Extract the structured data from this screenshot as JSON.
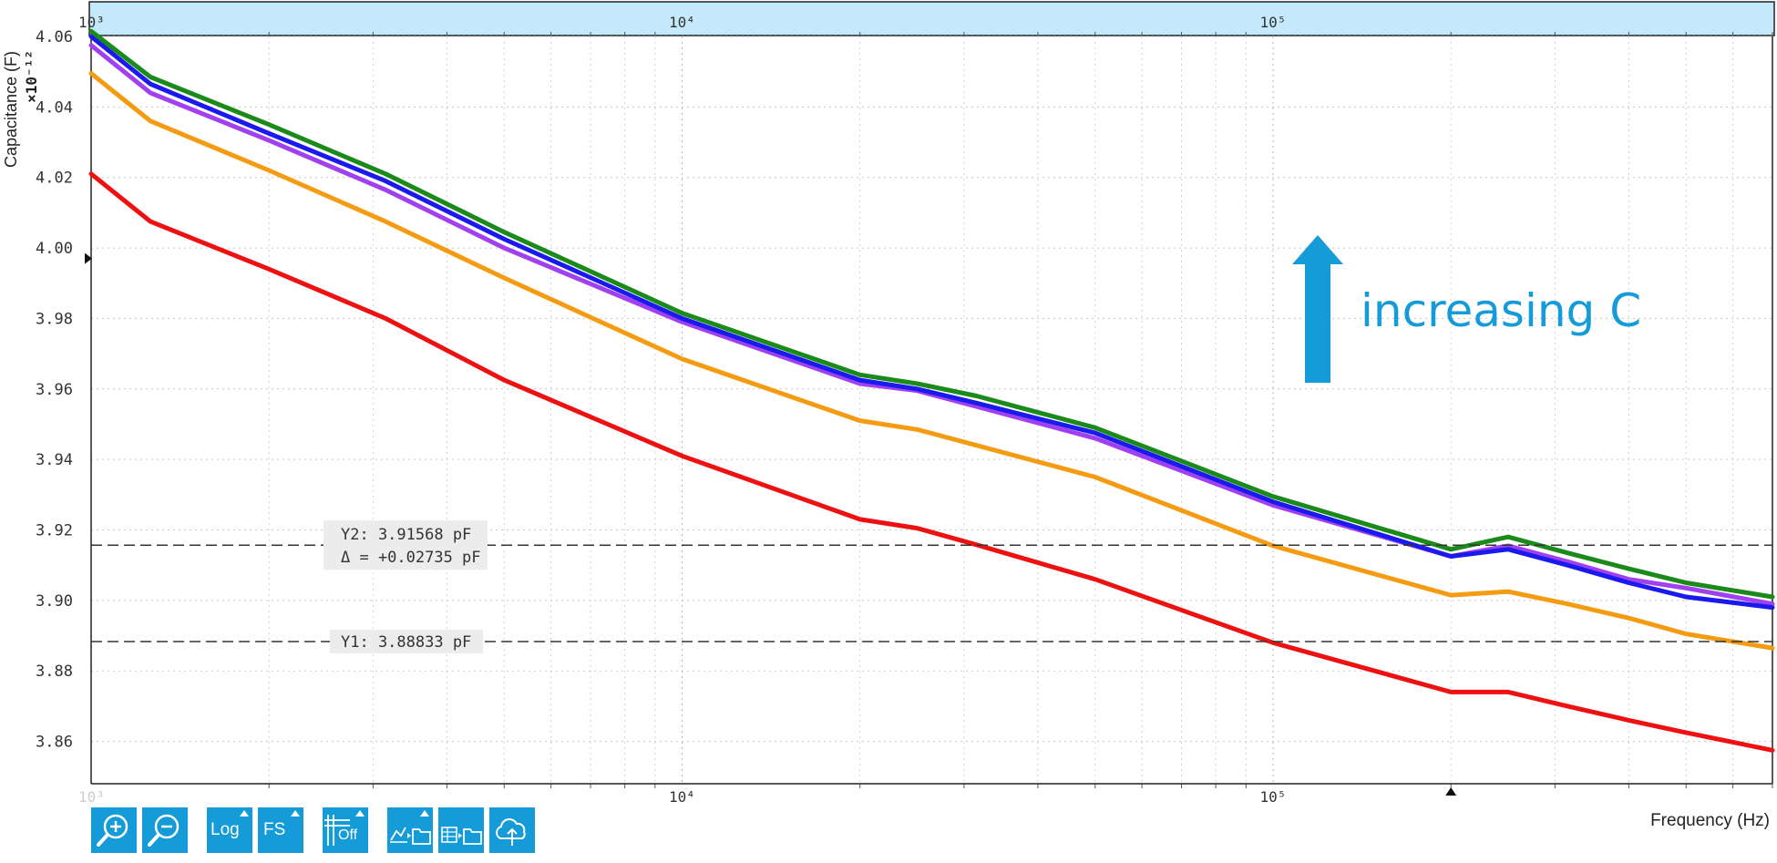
{
  "chart_data": {
    "type": "line",
    "xscale": "log",
    "x_tick_labels": [
      "10³",
      "10⁴",
      "10⁵"
    ],
    "x_tick_values": [
      1000,
      10000,
      100000
    ],
    "xlim": [
      1000,
      700000
    ],
    "ylim": [
      3.848,
      4.06
    ],
    "y_tick_labels": [
      "3.86",
      "3.88",
      "3.90",
      "3.92",
      "3.94",
      "3.96",
      "3.98",
      "4.00",
      "4.02",
      "4.04",
      "4.06"
    ],
    "y_tick_values": [
      3.86,
      3.88,
      3.9,
      3.92,
      3.94,
      3.96,
      3.98,
      4.0,
      4.02,
      4.04,
      4.06
    ],
    "y_exponent": "×10⁻¹²",
    "ylabel": "Capacitance (F)",
    "xlabel": "Frequency (Hz)",
    "grid": true,
    "x": [
      1000,
      1260,
      2000,
      3150,
      5000,
      10000,
      20000,
      25000,
      31500,
      50000,
      100000,
      200000,
      250000,
      315000,
      400000,
      500000,
      700000
    ],
    "series": [
      {
        "color": "#ee1111",
        "values": [
          4.021,
          4.0075,
          3.994,
          3.98,
          3.9625,
          3.941,
          3.923,
          3.9205,
          3.9158,
          3.906,
          3.888,
          3.874,
          3.874,
          3.87,
          3.866,
          3.8625,
          3.8575
        ]
      },
      {
        "color": "#f59b12",
        "values": [
          4.0495,
          4.036,
          4.022,
          4.0075,
          3.9915,
          3.9685,
          3.951,
          3.9485,
          3.944,
          3.935,
          3.9155,
          3.9015,
          3.9025,
          3.899,
          3.895,
          3.8905,
          3.8865
        ]
      },
      {
        "color": "#a040f0",
        "values": [
          4.0575,
          4.044,
          4.0305,
          4.0165,
          4.0,
          3.979,
          3.9615,
          3.9595,
          3.955,
          3.946,
          3.927,
          3.9125,
          3.9155,
          3.911,
          3.906,
          3.9035,
          3.899
        ]
      },
      {
        "color": "#1a1aee",
        "values": [
          4.06,
          4.0465,
          4.0325,
          4.019,
          4.0025,
          3.98,
          3.9625,
          3.96,
          3.956,
          3.9475,
          3.928,
          3.9125,
          3.9145,
          3.91,
          3.905,
          3.901,
          3.898
        ]
      },
      {
        "color": "#1a8a1a",
        "values": [
          4.0615,
          4.0485,
          4.035,
          4.021,
          4.0045,
          3.9815,
          3.964,
          3.9615,
          3.958,
          3.949,
          3.9295,
          3.9145,
          3.918,
          3.9135,
          3.909,
          3.905,
          3.901
        ]
      }
    ],
    "cursors": [
      {
        "id": "Y2",
        "value": 3.91568,
        "label": "Y2: 3.91568 pF",
        "delta": "Δ = +0.02735 pF"
      },
      {
        "id": "Y1",
        "value": 3.88833,
        "label": "Y1: 3.88833 pF"
      }
    ],
    "annotation": {
      "text": "increasing C",
      "color": "#159bd7"
    },
    "marker_x": 200000,
    "marker_y": 3.997
  },
  "toolbar": {
    "zoom_in": "zoom-in-icon",
    "zoom_out": "zoom-out-icon",
    "log_label": "Log",
    "fs_label": "FS",
    "grid_off_label": "Off",
    "export_chart": "chart-folder-icon",
    "export_table": "table-folder-icon",
    "upload": "cloud-upload-icon",
    "accent": "#159bd7"
  }
}
